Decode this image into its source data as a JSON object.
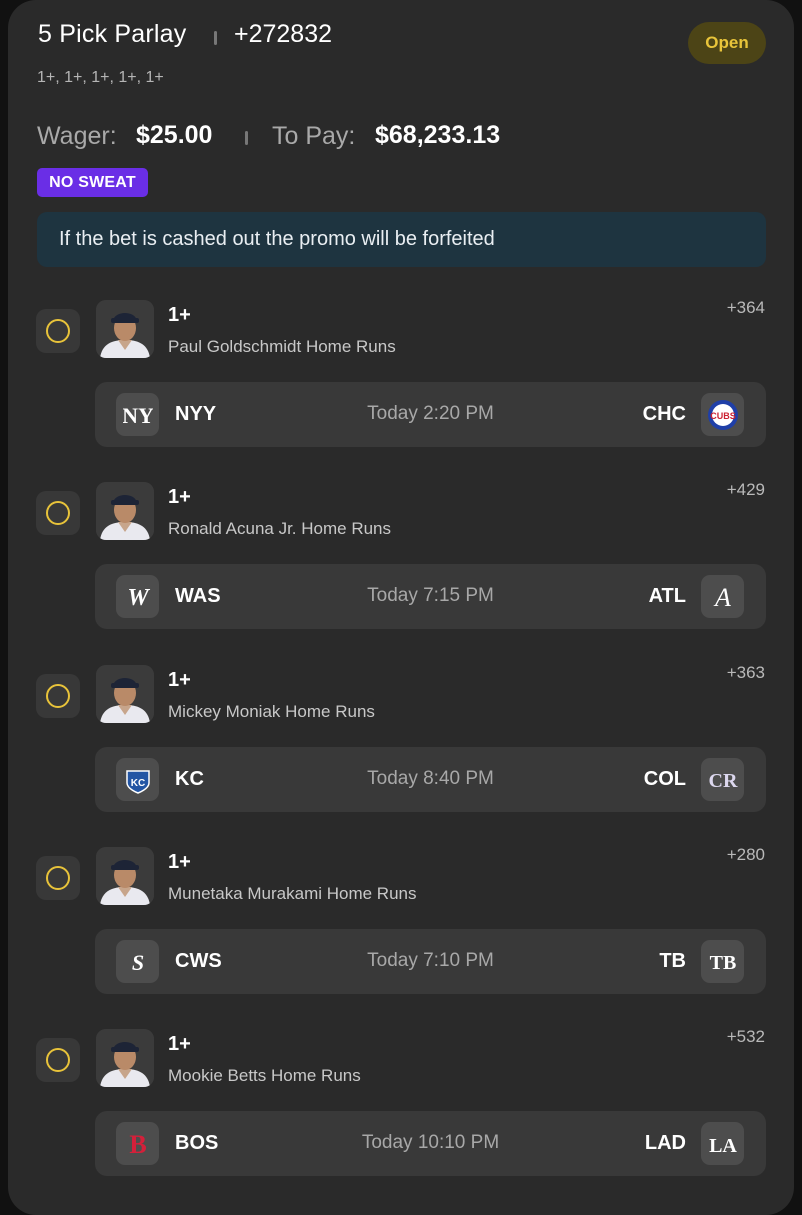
{
  "bet": {
    "title": "5 Pick Parlay",
    "odds": "+272832",
    "legs_summary": "1+, 1+, 1+, 1+, 1+",
    "status": "Open",
    "wager_label": "Wager:",
    "wager_value": "$25.00",
    "to_pay_label": "To Pay:",
    "to_pay_value": "$68,233.13",
    "promo_badge": "NO SWEAT",
    "promo_notice": "If the bet is cashed out the promo will be forfeited"
  },
  "colors": {
    "accent_yellow": "#e8c33a",
    "promo_purple": "#6a2ee6",
    "notice_bg": "#1e3440",
    "card_bg": "#2a2a2a"
  },
  "picks": [
    {
      "line": "1+",
      "market": "Paul Goldschmidt Home Runs",
      "price": "+364",
      "headshot_icon": "player-headshot-icon",
      "away_team": "NYY",
      "away_logo": "yankees-logo-icon",
      "time": "Today 2:20 PM",
      "home_team": "CHC",
      "home_logo": "cubs-logo-icon"
    },
    {
      "line": "1+",
      "market": "Ronald Acuna Jr. Home Runs",
      "price": "+429",
      "headshot_icon": "player-headshot-icon",
      "away_team": "WAS",
      "away_logo": "nationals-logo-icon",
      "time": "Today 7:15 PM",
      "home_team": "ATL",
      "home_logo": "braves-logo-icon"
    },
    {
      "line": "1+",
      "market": "Mickey Moniak Home Runs",
      "price": "+363",
      "headshot_icon": "player-headshot-icon",
      "away_team": "KC",
      "away_logo": "royals-logo-icon",
      "time": "Today 8:40 PM",
      "home_team": "COL",
      "home_logo": "rockies-logo-icon"
    },
    {
      "line": "1+",
      "market": "Munetaka Murakami Home Runs",
      "price": "+280",
      "headshot_icon": "player-headshot-icon",
      "away_team": "CWS",
      "away_logo": "white-sox-logo-icon",
      "time": "Today 7:10 PM",
      "home_team": "TB",
      "home_logo": "rays-logo-icon"
    },
    {
      "line": "1+",
      "market": "Mookie Betts Home Runs",
      "price": "+532",
      "headshot_icon": "player-headshot-icon",
      "away_team": "BOS",
      "away_logo": "red-sox-logo-icon",
      "time": "Today 10:10 PM",
      "home_team": "LAD",
      "home_logo": "dodgers-logo-icon"
    }
  ]
}
